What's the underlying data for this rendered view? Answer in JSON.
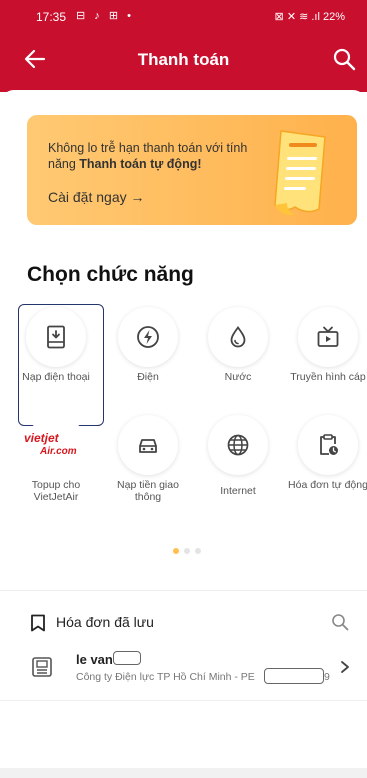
{
  "status_bar": {
    "time": "17:35",
    "indicators": "⊟ ♪ ⊞ •",
    "right": "⊠ ✕ ≋ .ıl 22%"
  },
  "header": {
    "title": "Thanh toán",
    "back_icon": "back-arrow-icon",
    "search_icon": "search-icon",
    "color": "#c8102e"
  },
  "banner": {
    "text_before": "Không lo trễ hạn thanh toán với tính năng ",
    "text_bold": "Thanh toán tự động!",
    "cta": "Cài đặt ngay →",
    "color": "#ffb14c"
  },
  "section": {
    "title": "Chọn chức năng"
  },
  "functions": [
    {
      "label": "Nạp điện thoại",
      "icon": "phone-topup-icon",
      "selected": true
    },
    {
      "label": "Điện",
      "icon": "lightning-icon",
      "selected": false
    },
    {
      "label": "Nước",
      "icon": "water-drop-icon",
      "selected": false
    },
    {
      "label": "Truyền hình cáp",
      "icon": "tv-icon",
      "selected": false
    },
    {
      "label": "Topup cho VietJetAir",
      "icon": "vietjetair-logo",
      "logo_text": "vietjet Air.com",
      "selected": false
    },
    {
      "label": "Nạp tiền giao thông",
      "icon": "car-icon",
      "selected": false
    },
    {
      "label": "Internet",
      "icon": "globe-icon",
      "selected": false
    },
    {
      "label": "Hóa đơn tự động",
      "icon": "auto-bill-icon",
      "selected": false
    }
  ],
  "pagination": {
    "total": 3,
    "active": 0,
    "active_color": "#ffc04d",
    "inactive_color": "#e4e4e4"
  },
  "saved_bills": {
    "label": "Hóa đơn đã lưu",
    "items": [
      {
        "name": "le van",
        "subtitle": "Công ty Điện lực TP Hồ Chí Minh - PE",
        "subtitle_tail": "9"
      }
    ]
  }
}
